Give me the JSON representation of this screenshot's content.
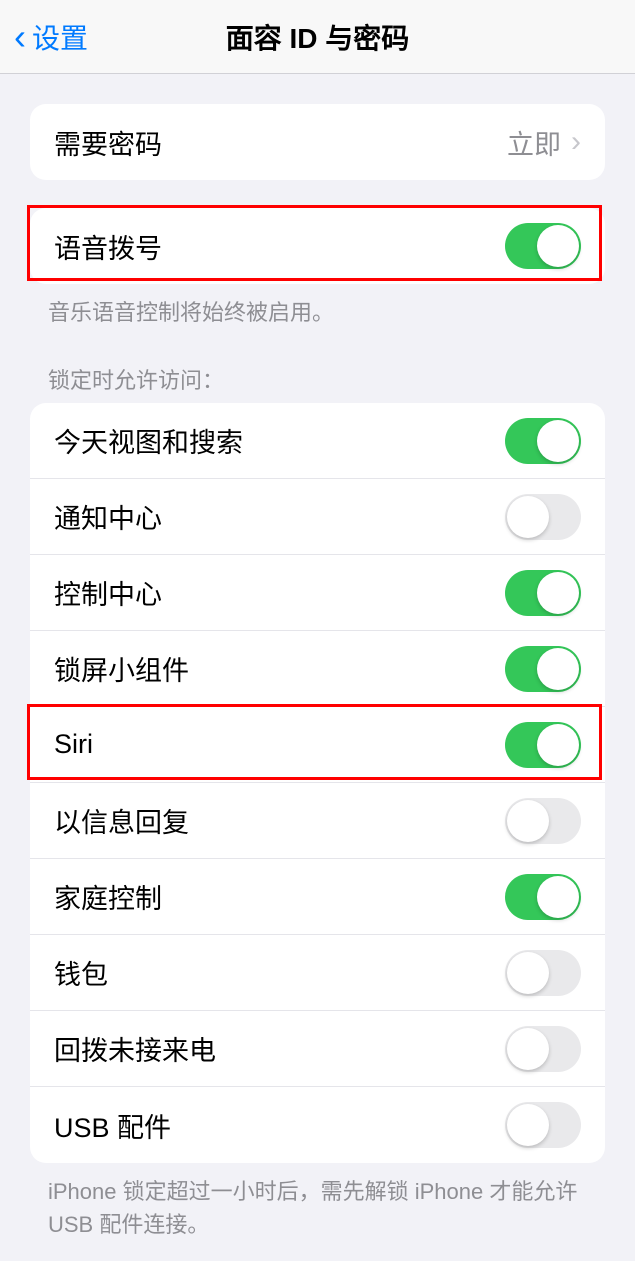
{
  "navbar": {
    "back_label": "设置",
    "title": "面容 ID 与密码"
  },
  "require_passcode": {
    "label": "需要密码",
    "value": "立即"
  },
  "voice_dial": {
    "label": "语音拨号",
    "on": true,
    "footer": "音乐语音控制将始终被启用。"
  },
  "lock_access": {
    "header": "锁定时允许访问：",
    "items": [
      {
        "label": "今天视图和搜索",
        "on": true
      },
      {
        "label": "通知中心",
        "on": false
      },
      {
        "label": "控制中心",
        "on": true
      },
      {
        "label": "锁屏小组件",
        "on": true
      },
      {
        "label": "Siri",
        "on": true
      },
      {
        "label": "以信息回复",
        "on": false
      },
      {
        "label": "家庭控制",
        "on": true
      },
      {
        "label": "钱包",
        "on": false
      },
      {
        "label": "回拨未接来电",
        "on": false
      },
      {
        "label": "USB 配件",
        "on": false
      }
    ],
    "footer": "iPhone 锁定超过一小时后，需先解锁 iPhone 才能允许 USB 配件连接。"
  }
}
